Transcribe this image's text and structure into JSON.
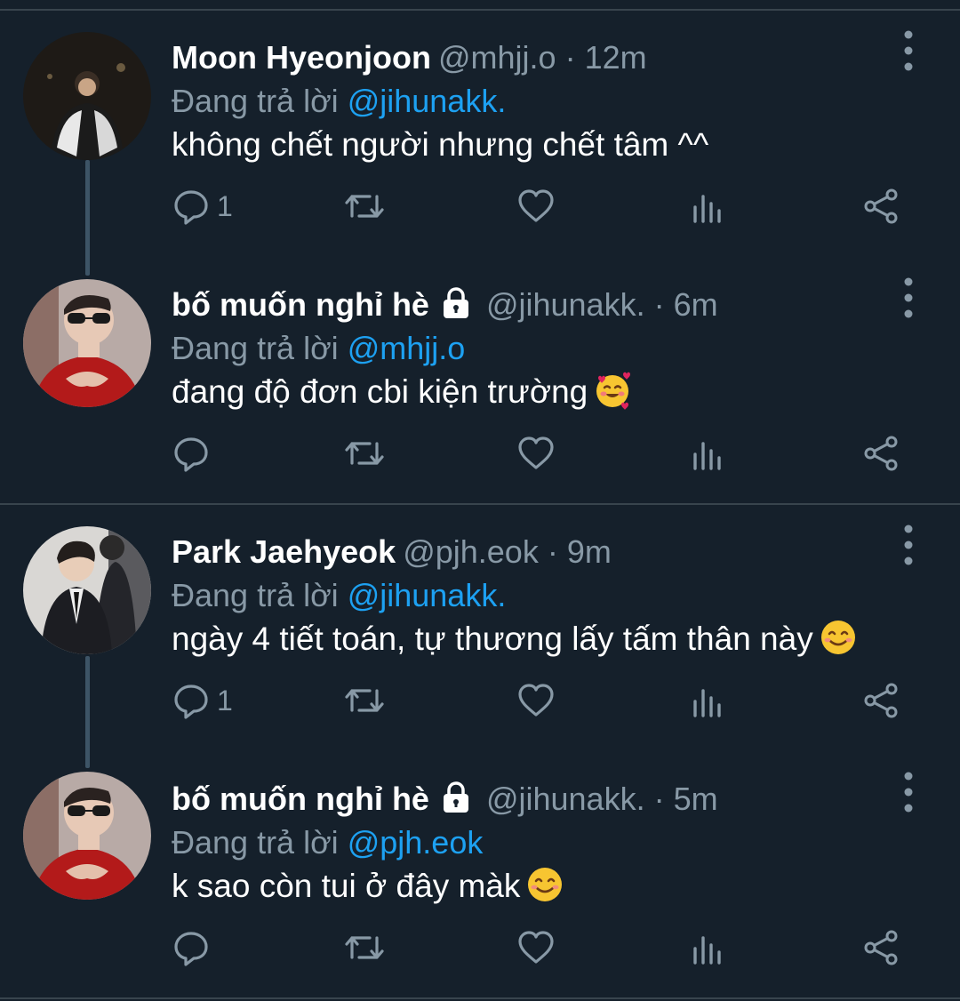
{
  "tweets": [
    {
      "name": "Moon Hyeonjoon",
      "locked": false,
      "handle": "@mhjj.o",
      "separator": "·",
      "time": "12m",
      "reply_prefix": "Đang trả lời",
      "reply_to": "@jihunakk.",
      "text": "không chết người nhưng chết tâm ^^",
      "emoji": "",
      "reply_count": "1",
      "avatar": "avatar-moon"
    },
    {
      "name": "bố muốn nghỉ hè",
      "locked": true,
      "handle": "@jihunakk.",
      "separator": "·",
      "time": "6m",
      "reply_prefix": "Đang trả lời",
      "reply_to": "@mhjj.o",
      "text": "đang độ đơn cbi kiện trường",
      "emoji": "smiling-face-with-hearts",
      "reply_count": "",
      "avatar": "avatar-jihun"
    },
    {
      "name": "Park Jaehyeok",
      "locked": false,
      "handle": "@pjh.eok",
      "separator": "·",
      "time": "9m",
      "reply_prefix": "Đang trả lời",
      "reply_to": "@jihunakk.",
      "text": "ngày 4 tiết toán, tự thương lấy tấm thân này",
      "emoji": "smiling-face",
      "reply_count": "1",
      "avatar": "avatar-park"
    },
    {
      "name": "bố muốn nghỉ hè",
      "locked": true,
      "handle": "@jihunakk.",
      "separator": "·",
      "time": "5m",
      "reply_prefix": "Đang trả lời",
      "reply_to": "@pjh.eok",
      "text": "k sao còn tui ở đây màk",
      "emoji": "smiling-face",
      "reply_count": "",
      "avatar": "avatar-jihun"
    }
  ],
  "colors": {
    "background": "#15202b",
    "secondary_text": "#8899a6",
    "link": "#1da1f2",
    "divider": "#38444d"
  }
}
